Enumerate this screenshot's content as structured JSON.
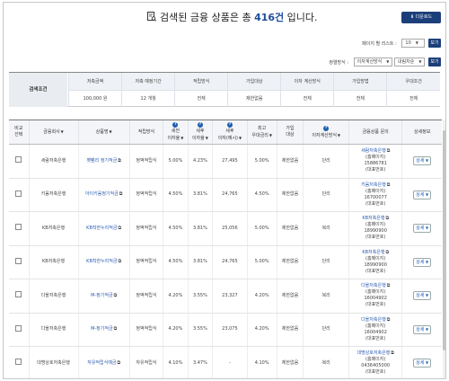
{
  "header": {
    "title_prefix": "검색된 금융 상품은 총 ",
    "count": "416건",
    "title_suffix": " 입니다.",
    "download_label": "다운로드"
  },
  "controls": {
    "per_page_label": "페이지 별 리스트 :",
    "per_page_value": "10",
    "per_page_btn": "보기",
    "sort_label": "정렬방식 :",
    "sort_value": "이자계산방식",
    "order_value": "내림차순",
    "sort_btn": "보기"
  },
  "criteria": {
    "label": "검색조건",
    "headers": [
      "저축금액",
      "저축 예정기간",
      "적립방식",
      "가입대상",
      "이자 계산방식",
      "가입방법",
      "우대조건"
    ],
    "values": [
      "100,000 원",
      "12 개월",
      "전체",
      "제한없음",
      "전체",
      "전체",
      "전체"
    ]
  },
  "table": {
    "headers": {
      "compare": "비교\n선택",
      "company": "금융회사",
      "product": "상품명",
      "method": "적립방식",
      "pre_rate": "세전\n이자율",
      "post_rate": "세후\n이자율",
      "post_interest": "세후\n이자(예시)",
      "max_rate": "최고\n우대금리",
      "target": "가입\n대상",
      "calc": "이자계산방식",
      "inquiry": "금융상품 문의",
      "detail": "상세정보"
    },
    "detail_btn": "상세",
    "rows": [
      {
        "company": "세람저축은행",
        "product": "펫팸리 정기적금",
        "method": "정액적립식",
        "pre": "5.00%",
        "post": "4.23%",
        "interest": "27,495",
        "max": "5.00%",
        "target": "제한없음",
        "calc": "단리",
        "bank": "세람저축은행",
        "hq": "(홈페이지)",
        "phone": "15886781",
        "rep": "(대표번호)"
      },
      {
        "company": "키움저축은행",
        "product": "아이키움정기적금",
        "method": "정액적립식",
        "pre": "4.50%",
        "post": "3.81%",
        "interest": "24,765",
        "max": "4.50%",
        "target": "제한없음",
        "calc": "단리",
        "bank": "키움저축은행",
        "hq": "(홈페이지)",
        "phone": "16700077",
        "rep": "(대표번호)"
      },
      {
        "company": "KB저축은행",
        "product": "KB착한누리적금",
        "method": "정액적립식",
        "pre": "4.50%",
        "post": "3.81%",
        "interest": "25,056",
        "max": "5.00%",
        "target": "제한없음",
        "calc": "복리",
        "bank": "KB저축은행",
        "hq": "(홈페이지)",
        "phone": "18990900",
        "rep": "(대표번호)"
      },
      {
        "company": "KB저축은행",
        "product": "KB착한누리적금",
        "method": "정액적립식",
        "pre": "4.50%",
        "post": "3.81%",
        "interest": "24,765",
        "max": "5.00%",
        "target": "제한없음",
        "calc": "단리",
        "bank": "KB저축은행",
        "hq": "(홈페이지)",
        "phone": "18990900",
        "rep": "(대표번호)"
      },
      {
        "company": "다올저축은행",
        "product": "M-정기적금",
        "method": "정액적립식",
        "pre": "4.20%",
        "post": "3.55%",
        "interest": "23,327",
        "max": "4.20%",
        "target": "제한없음",
        "calc": "복리",
        "bank": "다올저축은행",
        "hq": "(홈페이지)",
        "phone": "16004902",
        "rep": "(대표번호)"
      },
      {
        "company": "다올저축은행",
        "product": "M-정기적금",
        "method": "정액적립식",
        "pre": "4.20%",
        "post": "3.55%",
        "interest": "23,075",
        "max": "4.20%",
        "target": "제한없음",
        "calc": "단리",
        "bank": "다올저축은행",
        "hq": "(홈페이지)",
        "phone": "16004902",
        "rep": "(대표번호)"
      },
      {
        "company": "대명상호저축은행",
        "product": "자유적립식예금",
        "method": "자유적립식",
        "pre": "4.10%",
        "post": "3.47%",
        "interest": "-",
        "max": "4.10%",
        "target": "제한없음",
        "calc": "복리",
        "bank": "대명상호저축은행",
        "hq": "(홈페이지)",
        "phone": "0436405000",
        "rep": "(대표번호)"
      }
    ]
  }
}
